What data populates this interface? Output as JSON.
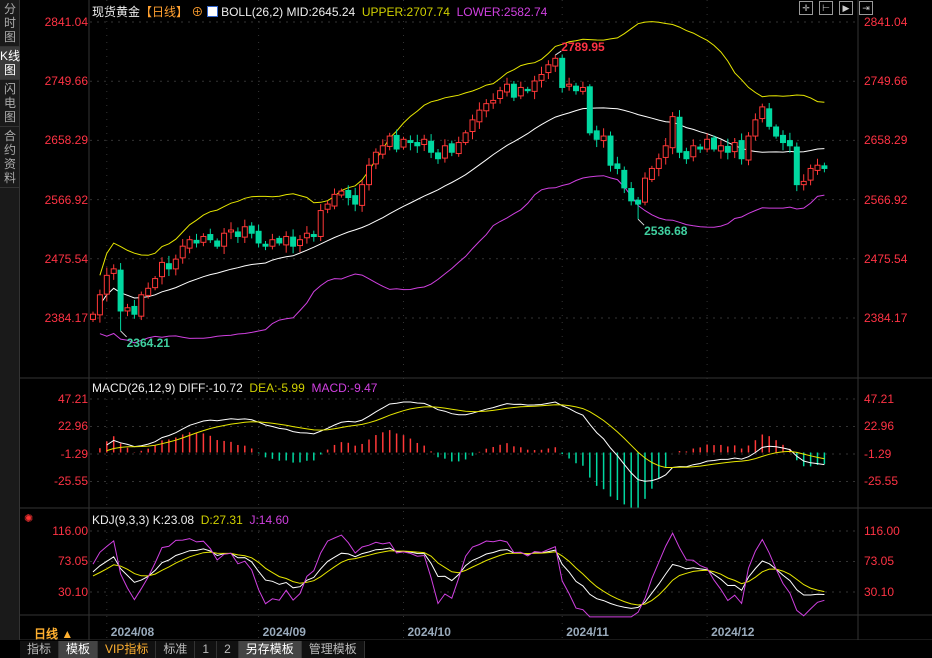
{
  "sidebar": {
    "tabs": [
      "分时图",
      "K线图",
      "闪电图",
      "合约资料"
    ],
    "active": 1
  },
  "header": {
    "title": "现货黄金",
    "period": "【日线】",
    "boll": "BOLL(26,2)",
    "mid": "MID:2645.24",
    "upper": "UPPER:2707.74",
    "lower": "LOWER:2582.74"
  },
  "macd_header": {
    "name": "MACD(26,12,9)",
    "diff": "DIFF:-10.72",
    "dea": "DEA:-5.99",
    "macd": "MACD:-9.47"
  },
  "kdj_header": {
    "name": "KDJ(9,3,3)",
    "k": "K:23.08",
    "d": "D:27.31",
    "j": "J:14.60"
  },
  "period_selector": {
    "label": "日线",
    "arrow": "▲"
  },
  "bottom_tabs": [
    "指标",
    "模板",
    "VIP指标",
    "标准",
    "1",
    "2",
    "另存模板",
    "管理模板"
  ],
  "toolbar_icons": [
    "crosshair-icon",
    "zoom-in-icon",
    "zoom-out-icon",
    "shift-right-icon"
  ],
  "colors": {
    "up": "#ff3838",
    "down": "#00d8a0",
    "mid": "#ffffff",
    "upper": "#e6e600",
    "lower": "#d040e0",
    "axis": "#ff3344"
  },
  "chart_data": {
    "type": "candlestick",
    "title": "现货黄金 日线",
    "price_axis": {
      "ticks": [
        "2841.04",
        "2749.66",
        "2658.29",
        "2566.92",
        "2475.54",
        "2384.17"
      ],
      "range": [
        2384.17,
        2841.04
      ]
    },
    "macd_axis": {
      "ticks": [
        "47.21",
        "22.96",
        "-1.29",
        "-25.55"
      ],
      "range": [
        -25.55,
        47.21
      ]
    },
    "kdj_axis": {
      "ticks": [
        "116.00",
        "73.05",
        "30.10"
      ],
      "range": [
        30.1,
        116.0
      ]
    },
    "date_ticks": [
      {
        "label": "2024/08",
        "index": 2
      },
      {
        "label": "2024/09",
        "index": 24
      },
      {
        "label": "2024/10",
        "index": 45
      },
      {
        "label": "2024/11",
        "index": 68
      },
      {
        "label": "2024/12",
        "index": 89
      }
    ],
    "annotations": [
      {
        "label": "2789.95",
        "index": 67,
        "value": 2789.95,
        "type": "high"
      },
      {
        "label": "2536.68",
        "index": 79,
        "value": 2536.68,
        "type": "low"
      },
      {
        "label": "2364.21",
        "index": 4,
        "value": 2364.21,
        "type": "low"
      }
    ],
    "closes": [
      2390,
      2420,
      2450,
      2460,
      2395,
      2400,
      2390,
      2420,
      2430,
      2445,
      2470,
      2460,
      2475,
      2495,
      2505,
      2500,
      2510,
      2505,
      2495,
      2515,
      2520,
      2510,
      2525,
      2515,
      2500,
      2495,
      2505,
      2500,
      2510,
      2495,
      2505,
      2515,
      2510,
      2550,
      2560,
      2575,
      2580,
      2570,
      2560,
      2590,
      2620,
      2640,
      2650,
      2665,
      2645,
      2660,
      2655,
      2650,
      2660,
      2640,
      2630,
      2650,
      2640,
      2655,
      2670,
      2690,
      2705,
      2715,
      2720,
      2735,
      2745,
      2725,
      2740,
      2735,
      2750,
      2760,
      2775,
      2785,
      2740,
      2745,
      2735,
      2740,
      2670,
      2660,
      2665,
      2620,
      2615,
      2585,
      2565,
      2560,
      2600,
      2615,
      2630,
      2650,
      2695,
      2640,
      2630,
      2650,
      2645,
      2660,
      2645,
      2650,
      2640,
      2655,
      2630,
      2665,
      2690,
      2710,
      2680,
      2665,
      2655,
      2650,
      2590,
      2595,
      2615,
      2620,
      2615
    ]
  }
}
